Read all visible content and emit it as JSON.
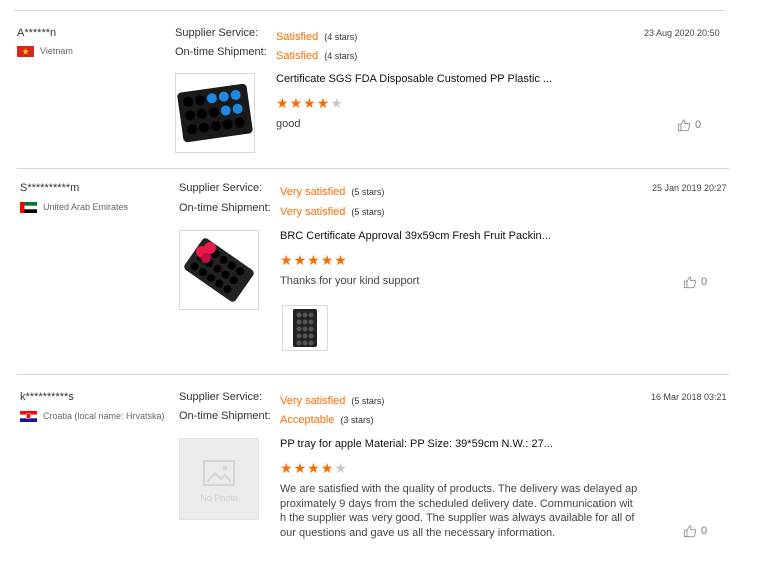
{
  "reviews": [
    {
      "user": "A******n",
      "country": "Vietnam",
      "flag": "vietnam",
      "service_label": "Supplier Service:",
      "service_value": "Satisfied",
      "service_stars": "(4 stars)",
      "shipment_label": "On-time Shipment:",
      "shipment_value": "Satisfied",
      "shipment_stars": "(4 stars)",
      "date": "23 Aug 2020 20:50",
      "product": "Certificate SGS FDA Disposable Customed PP Plastic ...",
      "rating": 4,
      "comment": "good",
      "likes": "0"
    },
    {
      "user": "S**********m",
      "country": "United Arab Emirates",
      "flag": "uae",
      "service_label": "Supplier Service:",
      "service_value": "Very satisfied",
      "service_stars": "(5 stars)",
      "shipment_label": "On-time Shipment:",
      "shipment_value": "Very satisfied",
      "shipment_stars": "(5 stars)",
      "date": "25 Jan 2019 20:27",
      "product": "BRC Certificate Approval 39x59cm Fresh Fruit Packin...",
      "rating": 5,
      "comment": "Thanks for your kind support",
      "likes": "0"
    },
    {
      "user": "k**********s",
      "country": "Croatia (local name: Hrvatska)",
      "flag": "croatia",
      "service_label": "Supplier Service:",
      "service_value": "Very satisfied",
      "service_stars": "(5 stars)",
      "shipment_label": "On-time Shipment:",
      "shipment_value": "Acceptable",
      "shipment_stars": "(3 stars)",
      "date": "16 Mar 2018 03:21",
      "product": "PP tray for apple Material: PP Size: 39*59cm N.W.: 27...",
      "rating": 4,
      "comment_lines": [
        "We are satisfied with the quality of products. The delivery was delayed ap",
        "proximately 9 days from the scheduled delivery date. Communication wit",
        "h the supplier was very good. The supplier was always available for all of",
        "our questions and gave us all the necessary information."
      ],
      "no_photo": "No Photo",
      "likes": "0"
    }
  ],
  "colors": {
    "accent": "#ff6a00",
    "star_off": "#c8c8c8"
  },
  "icons": [
    "thumbs-up-icon",
    "star-icon",
    "flag-icon",
    "image-placeholder-icon"
  ]
}
